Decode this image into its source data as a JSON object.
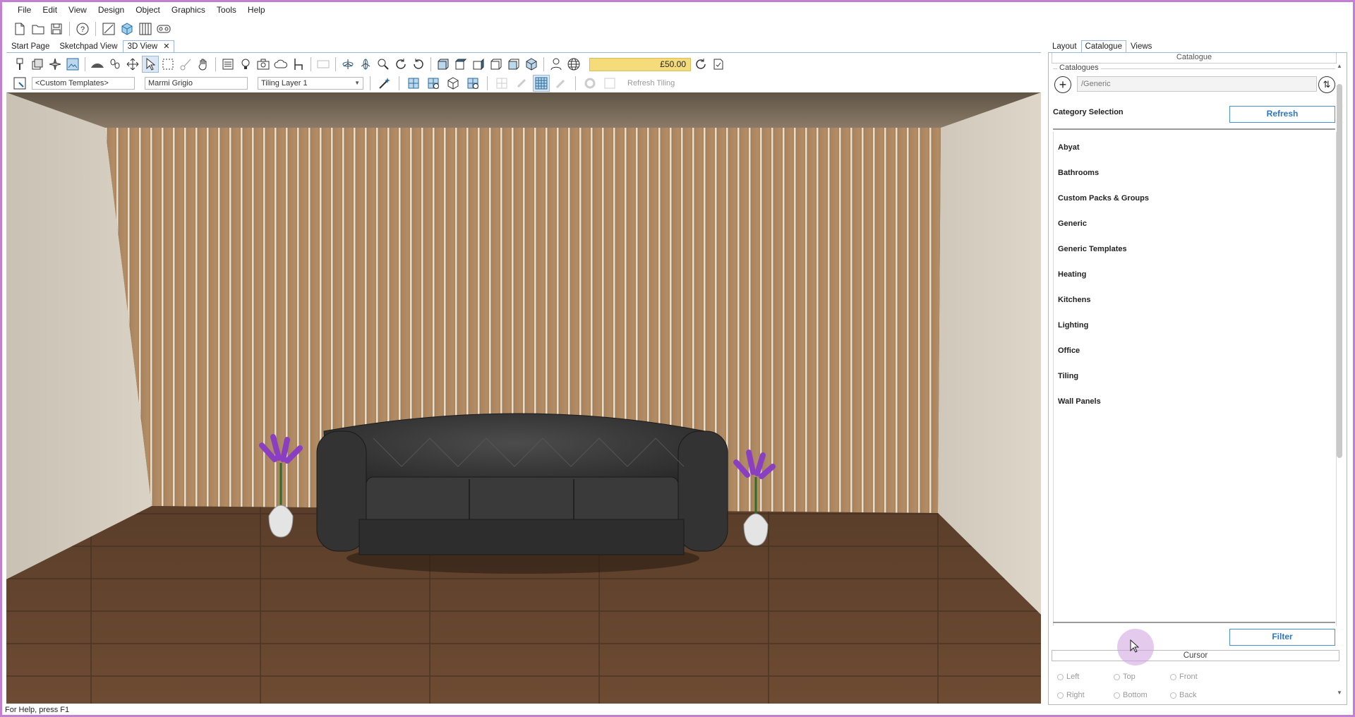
{
  "menu": [
    "File",
    "Edit",
    "View",
    "Design",
    "Object",
    "Graphics",
    "Tools",
    "Help"
  ],
  "main_toolbar_icons": [
    "new-file-icon",
    "open-folder-icon",
    "save-icon",
    "help-icon",
    "sketch-layout-icon",
    "3d-box-icon",
    "panel-view-icon",
    "vr-headset-icon"
  ],
  "doc_tabs": [
    {
      "label": "Start Page",
      "active": false
    },
    {
      "label": "Sketchpad View",
      "active": false
    },
    {
      "label": "3D View",
      "active": true
    }
  ],
  "view_toolbar": {
    "price": "£50.00",
    "template_combo": "<Custom Templates>",
    "material_field": "Marmi Grigio",
    "layer_combo": "Tiling Layer 1",
    "refresh_tiling": "Refresh Tiling"
  },
  "status": "For Help, press F1",
  "side_tabs": [
    {
      "label": "Layout",
      "active": false
    },
    {
      "label": "Catalogue",
      "active": true
    },
    {
      "label": "Views",
      "active": false
    }
  ],
  "catalogue": {
    "header": "Catalogue",
    "catalogues_label": "Catalogues",
    "path": "/Generic",
    "category_selection": "Category Selection",
    "refresh": "Refresh",
    "categories": [
      "Abyat",
      "Bathrooms",
      "Custom Packs & Groups",
      "Generic",
      "Generic Templates",
      "Heating",
      "Kitchens",
      "Lighting",
      "Office",
      "Tiling",
      "Wall Panels"
    ],
    "filter": "Filter",
    "cursor_header": "Cursor",
    "cursor_row1": [
      "Left",
      "Top",
      "Front"
    ],
    "cursor_row2": [
      "Right",
      "Bottom",
      "Back"
    ]
  }
}
